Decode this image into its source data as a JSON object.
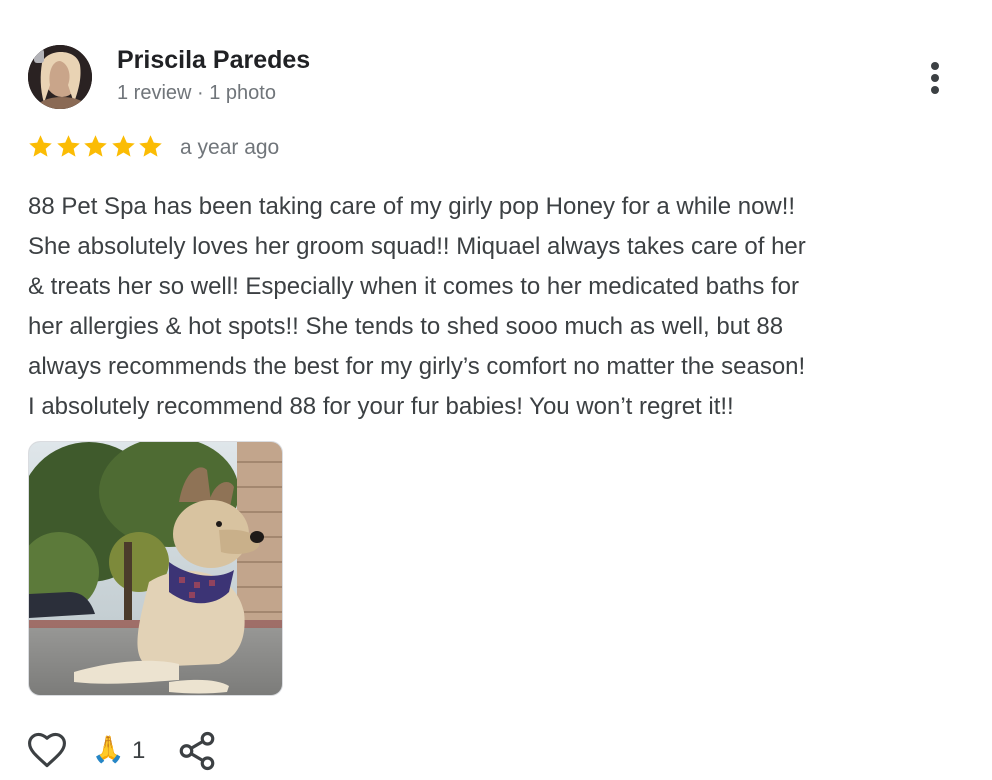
{
  "author": {
    "name": "Priscila Paredes",
    "meta": "1 review · 1 photo"
  },
  "rating": {
    "stars": 5,
    "max": 5,
    "color": "#fbbc04",
    "time_ago": "a year ago"
  },
  "review": {
    "lines": [
      "88 Pet Spa has been taking care of my girly pop Honey for a while now!!",
      "She absolutely loves her groom squad!! Miquael always takes care of her",
      "& treats her so well! Especially when it comes to her medicated baths for",
      "her allergies & hot spots!! She tends to shed sooo much as well, but 88",
      "always recommends the best for my girly’s comfort no matter the season!",
      "I absolutely recommend 88 for your fur babies! You won’t regret it!!"
    ]
  },
  "actions": {
    "like_icon": "heart-outline-icon",
    "reaction_emoji": "🙏",
    "reaction_count": "1",
    "share_icon": "share-icon"
  },
  "icons": {
    "more": "more-vertical-icon",
    "star": "star-icon"
  }
}
